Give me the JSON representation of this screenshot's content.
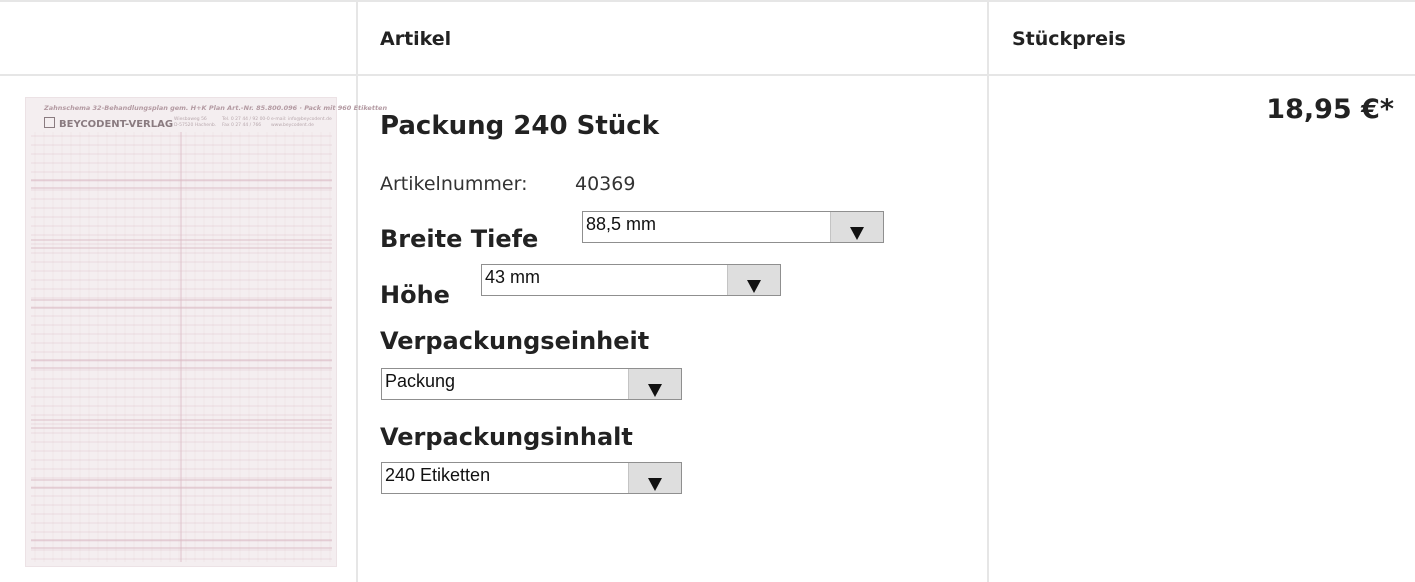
{
  "table": {
    "headers": {
      "image": "",
      "article": "Artikel",
      "unit_price": "Stückpreis"
    }
  },
  "product": {
    "image": {
      "caption": "Zahnschema 32-Behandlungsplan gem. H+K Plan   Art.-Nr. 85.800.096 · Pack mit 960 Etiketten",
      "logo_text": "BEYCODENT-VERLAG",
      "address_lines": [
        "Wiesbaweg 56",
        "D-57520 Hachenb."
      ],
      "contact_lines": [
        "Tel. 0 27 44 / 92 00-0",
        "Fax 0 27 44 / 766"
      ],
      "web_lines": [
        "e-mail: info@beycodent.de",
        "www.beycodent.de"
      ]
    },
    "title": "Packung 240 Stück",
    "article_number_label": "Artikelnummer:",
    "article_number": "40369",
    "options": {
      "breite_tiefe": {
        "label": "Breite Tiefe",
        "value": "88,5 mm"
      },
      "hoehe": {
        "label": "Höhe",
        "value": "43 mm"
      },
      "verpackungseinheit": {
        "label": "Verpackungseinheit",
        "value": "Packung"
      },
      "verpackungsinhalt": {
        "label": "Verpackungsinhalt",
        "value": "240 Etiketten"
      }
    },
    "price": "18,95 €*"
  },
  "icons": {
    "select_arrow": "triangle-down-icon"
  },
  "colors": {
    "border": "#e6e6e6",
    "label_sheet": "#f4eef0",
    "label_grid": "#d9b8c2",
    "select_button": "#dedede"
  }
}
